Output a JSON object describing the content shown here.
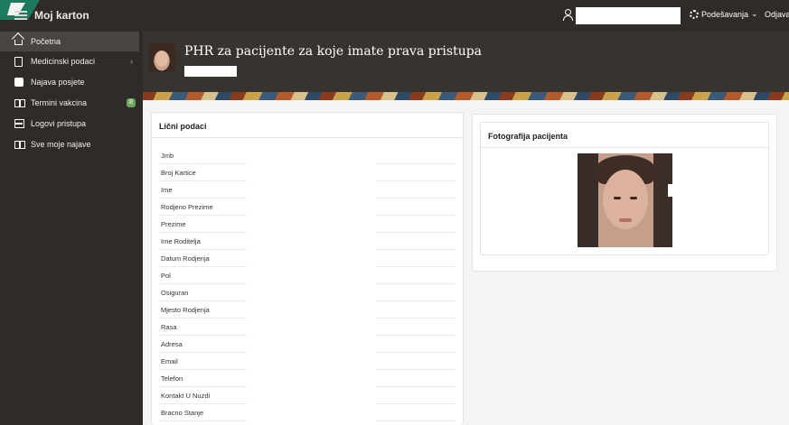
{
  "app": {
    "title": "Moj karton"
  },
  "header": {
    "user_name": "",
    "settings_label": "Podešavanja",
    "logout_label": "Odjava"
  },
  "sidebar": {
    "items": [
      {
        "label": "Početna",
        "icon": "home-icon",
        "active": true
      },
      {
        "label": "Medicinski podaci",
        "icon": "document-icon",
        "has_children": true
      },
      {
        "label": "Najava posjete",
        "icon": "phone-icon"
      },
      {
        "label": "Termini vakcina",
        "icon": "book-icon",
        "badge": "8"
      },
      {
        "label": "Logovi pristupa",
        "icon": "tray-icon"
      },
      {
        "label": "Sve moje najave",
        "icon": "book-icon"
      }
    ]
  },
  "hero": {
    "title": "PHR za pacijente za koje imate prava pristupa",
    "subtitle": ""
  },
  "personal": {
    "title": "Lični podaci",
    "fields": [
      "Jmb",
      "Broj Kartice",
      "Ime",
      "Rodjeno Prezime",
      "Prezime",
      "Ime Roditelja",
      "Datum Rodjenja",
      "Pol",
      "Osiguran",
      "Mjesto Rodjenja",
      "Rasa",
      "Adresa",
      "Email",
      "Telefon",
      "Kontakt U Nuzdi",
      "Bracno Stanje"
    ]
  },
  "photo": {
    "title": "Fotografija pacijenta"
  },
  "colors": {
    "topbar": "#2f2b28",
    "badge": "#6ba85a",
    "hero": "#37332f"
  }
}
